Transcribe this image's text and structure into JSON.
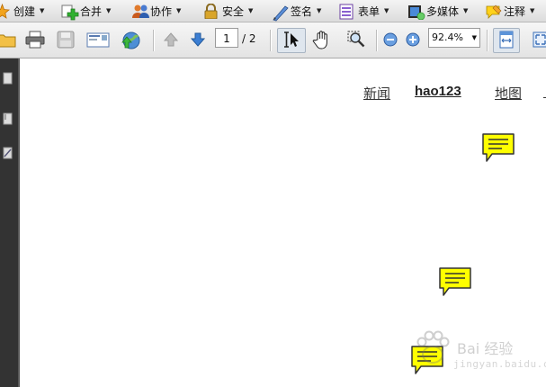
{
  "menubar": {
    "items": [
      {
        "label": "创建",
        "icon": "create-star-icon"
      },
      {
        "label": "合并",
        "icon": "combine-plus-icon"
      },
      {
        "label": "协作",
        "icon": "collaborate-people-icon"
      },
      {
        "label": "安全",
        "icon": "security-lock-icon"
      },
      {
        "label": "签名",
        "icon": "sign-pen-icon"
      },
      {
        "label": "表单",
        "icon": "forms-icon"
      },
      {
        "label": "多媒体",
        "icon": "multimedia-film-icon"
      },
      {
        "label": "注释",
        "icon": "comment-icon"
      }
    ]
  },
  "toolbar": {
    "page_current": "1",
    "page_total": "/ 2",
    "zoom": "92.4%"
  },
  "document": {
    "links": [
      "新闻",
      "hao123",
      "地图"
    ],
    "watermark_text": "Bai 经验",
    "watermark_sub": "jingyan.baidu.com"
  },
  "colors": {
    "note_fill": "#ffff00",
    "panel_dark": "#333333",
    "toolbar_bg": "#e8e8e8"
  }
}
